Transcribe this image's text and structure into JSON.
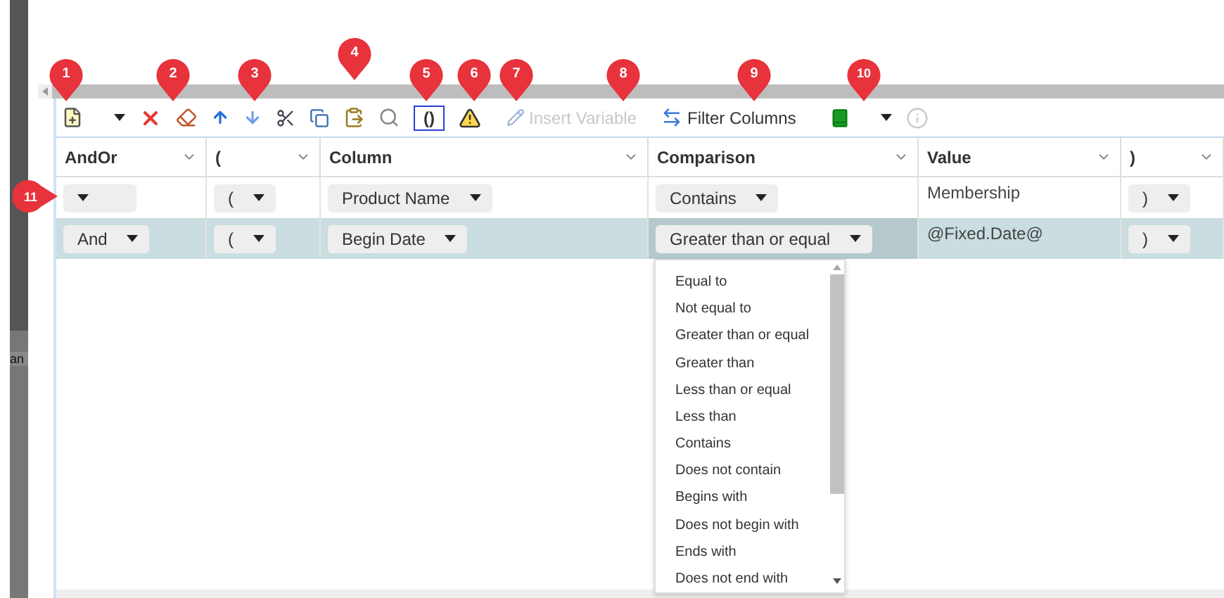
{
  "side_panel": {
    "label": "an"
  },
  "toolbar": {
    "group_button": {
      "label": "()",
      "selected": true
    },
    "insert_variable": {
      "label": "Insert Variable",
      "disabled": true
    },
    "filter_columns": {
      "label": "Filter Columns",
      "disabled": false
    },
    "info": {
      "disabled": true
    }
  },
  "callouts": [
    {
      "label": "1"
    },
    {
      "label": "2"
    },
    {
      "label": "3"
    },
    {
      "label": "4"
    },
    {
      "label": "5"
    },
    {
      "label": "6"
    },
    {
      "label": "7"
    },
    {
      "label": "8"
    },
    {
      "label": "9"
    },
    {
      "label": "10"
    },
    {
      "label": "11"
    }
  ],
  "table": {
    "columns": [
      "AndOr",
      "(",
      "Column",
      "Comparison",
      "Value",
      ")"
    ],
    "rows": [
      {
        "selected": false,
        "cells": [
          {
            "kind": "select"
          },
          {
            "kind": "select",
            "value": "("
          },
          {
            "kind": "select",
            "value": "Product Name"
          },
          {
            "kind": "select",
            "value": "Contains",
            "open": false
          },
          {
            "kind": "text",
            "value": "Membership"
          },
          {
            "kind": "select",
            "value": ")"
          }
        ]
      },
      {
        "selected": true,
        "cells": [
          {
            "kind": "select",
            "value": "And"
          },
          {
            "kind": "select",
            "value": "("
          },
          {
            "kind": "select",
            "value": "Begin Date"
          },
          {
            "kind": "select",
            "value": "Greater than or equal",
            "open": true
          },
          {
            "kind": "text",
            "value": "@Fixed.Date@"
          },
          {
            "kind": "select",
            "value": ")"
          }
        ]
      }
    ]
  },
  "dropdown_options": [
    {
      "label": "Equal to",
      "selected": false
    },
    {
      "label": "Not equal to",
      "selected": false
    },
    {
      "label": "Greater than or equal",
      "selected": false
    },
    {
      "label": "Greater than",
      "selected": false
    },
    {
      "label": "Less than or equal",
      "selected": false
    },
    {
      "label": "Less than",
      "selected": false
    },
    {
      "label": "Contains",
      "selected": false
    },
    {
      "label": "Does not contain",
      "selected": false
    },
    {
      "label": "Begins with",
      "selected": false
    },
    {
      "label": "Does not begin with",
      "selected": false
    },
    {
      "label": "Ends with",
      "selected": false
    },
    {
      "label": "Does not end with",
      "selected": false
    }
  ]
}
